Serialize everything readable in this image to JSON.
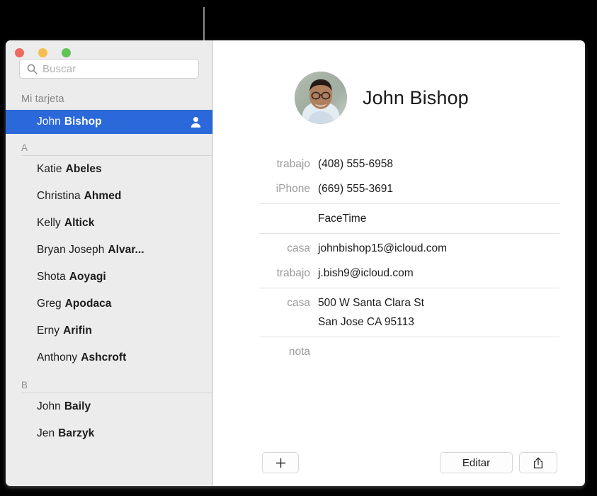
{
  "window": {
    "traffic_lights": [
      {
        "name": "close",
        "color": "#ed6a5e"
      },
      {
        "name": "minimize",
        "color": "#f5bd4f"
      },
      {
        "name": "zoom",
        "color": "#61c454"
      }
    ]
  },
  "sidebar": {
    "search": {
      "placeholder": "Buscar",
      "icon": "search-icon"
    },
    "my_card_label": "Mi tarjeta",
    "selected_contact": {
      "first": "John",
      "last": "Bishop",
      "icon": "person-icon"
    },
    "sections": [
      {
        "letter": "A",
        "contacts": [
          {
            "first": "Katie",
            "last": "Abeles"
          },
          {
            "first": "Christina",
            "last": "Ahmed"
          },
          {
            "first": "Kelly",
            "last": "Altick"
          },
          {
            "first": "Bryan Joseph",
            "last": "Alvar..."
          },
          {
            "first": "Shota",
            "last": "Aoyagi"
          },
          {
            "first": "Greg",
            "last": "Apodaca"
          },
          {
            "first": "Erny",
            "last": "Arifin"
          },
          {
            "first": "Anthony",
            "last": "Ashcroft"
          }
        ]
      },
      {
        "letter": "B",
        "contacts": [
          {
            "first": "John",
            "last": "Baily"
          },
          {
            "first": "Jen",
            "last": "Barzyk"
          }
        ]
      }
    ]
  },
  "detail": {
    "name": "John Bishop",
    "avatar_alt": "contact-photo",
    "field_groups": [
      {
        "rows": [
          {
            "label": "trabajo",
            "value": "(408) 555-6958"
          },
          {
            "label": "iPhone",
            "value": "(669) 555-3691"
          }
        ]
      },
      {
        "rows": [
          {
            "label": "",
            "value": "FaceTime"
          }
        ]
      },
      {
        "rows": [
          {
            "label": "casa",
            "value": "johnbishop15@icloud.com"
          },
          {
            "label": "trabajo",
            "value": "j.bish9@icloud.com"
          }
        ]
      },
      {
        "rows": [
          {
            "label": "casa",
            "value": "500 W Santa Clara St\nSan Jose CA 95113"
          }
        ]
      },
      {
        "rows": [
          {
            "label": "nota",
            "value": ""
          }
        ]
      }
    ]
  },
  "toolbar": {
    "add_label": "+",
    "add_icon": "plus-icon",
    "edit_label": "Editar",
    "share_icon": "share-icon"
  }
}
